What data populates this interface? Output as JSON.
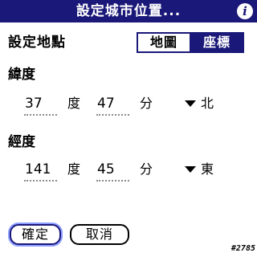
{
  "window": {
    "title": "設定城市位置..."
  },
  "icons": {
    "info": "info-icon",
    "dropdown": "triangle-down-icon"
  },
  "colors": {
    "titlebar": "#1a1878",
    "selected_segment": "#1a1878",
    "focus_ring": "#8fa0ff"
  },
  "location": {
    "label": "設定地點",
    "options": [
      "地圖",
      "座標"
    ],
    "selected": "座標"
  },
  "latitude": {
    "label": "緯度",
    "degrees": "37",
    "degrees_unit": "度",
    "minutes": "47",
    "minutes_unit": "分",
    "direction": "北"
  },
  "longitude": {
    "label": "經度",
    "degrees": "141",
    "degrees_unit": "度",
    "minutes": "45",
    "minutes_unit": "分",
    "direction": "東"
  },
  "buttons": {
    "ok": "確定",
    "cancel": "取消"
  },
  "build_number": "#2785"
}
